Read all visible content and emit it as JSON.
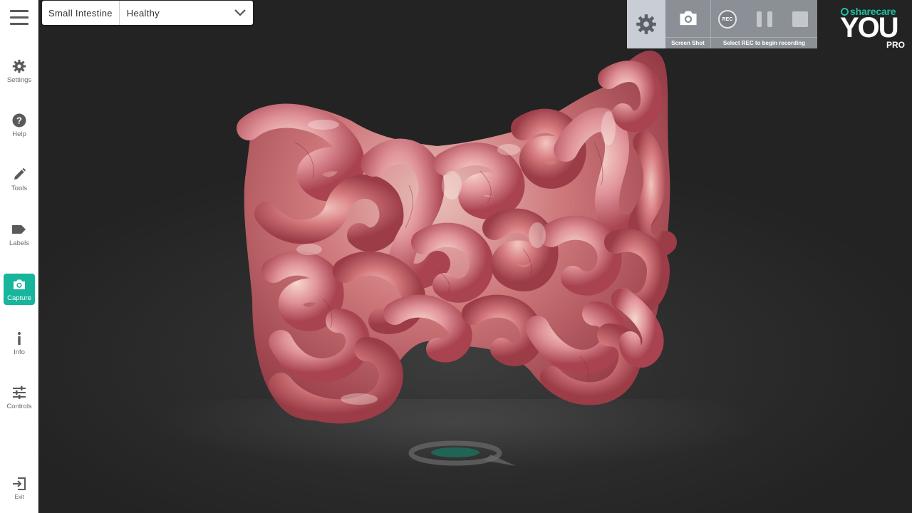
{
  "sidebar": {
    "items": [
      {
        "label": "Settings",
        "icon": "gear-icon"
      },
      {
        "label": "Help",
        "icon": "help-icon"
      },
      {
        "label": "Tools",
        "icon": "pencil-icon"
      },
      {
        "label": "Labels",
        "icon": "tag-icon"
      },
      {
        "label": "Capture",
        "icon": "camera-icon",
        "active": true
      },
      {
        "label": "Info",
        "icon": "info-icon"
      },
      {
        "label": "Controls",
        "icon": "sliders-icon"
      }
    ],
    "exit_label": "Exit"
  },
  "topbar": {
    "model_name": "Small Intestine",
    "state_value": "Healthy"
  },
  "capture_toolbar": {
    "screenshot_label": "Screen Shot",
    "rec_button_label": "REC",
    "recording_hint": "Select REC to begin recording"
  },
  "brand": {
    "company": "sharecare",
    "product": "YOU",
    "tier": "PRO"
  },
  "colors": {
    "accent": "#17b59b",
    "toolbar": "#8a9096",
    "tissue": "#c9656e"
  }
}
